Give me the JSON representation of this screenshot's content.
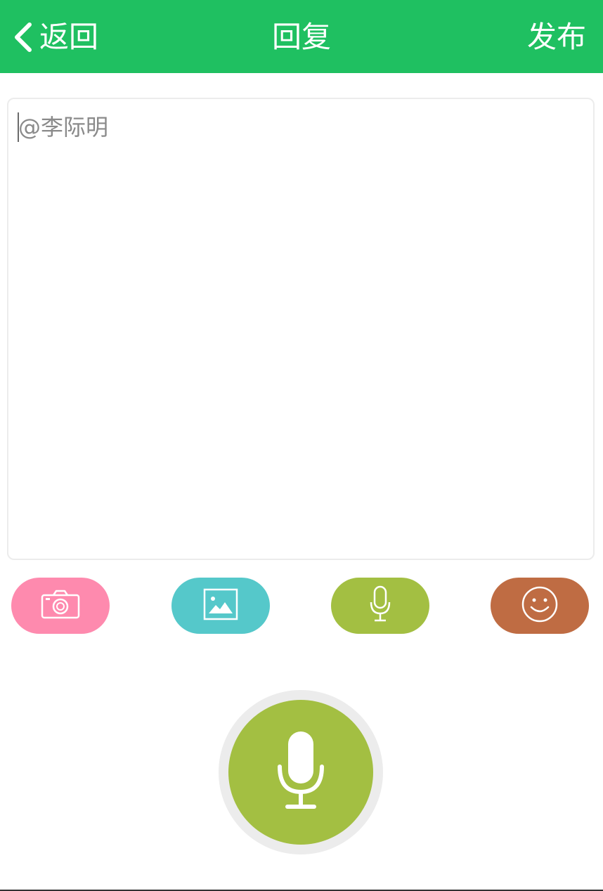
{
  "header": {
    "back_label": "返回",
    "title": "回复",
    "publish_label": "发布"
  },
  "reply": {
    "placeholder": "@李际明",
    "value": ""
  },
  "toolbar": {
    "items": [
      {
        "icon": "camera-icon",
        "color": "#fe8aae"
      },
      {
        "icon": "image-icon",
        "color": "#55c8ca"
      },
      {
        "icon": "microphone-icon",
        "color": "#a3bf42"
      },
      {
        "icon": "smiley-icon",
        "color": "#bf6c43"
      }
    ]
  },
  "record": {
    "icon": "microphone-icon",
    "color": "#a3bf42",
    "ring_color": "#ececec"
  },
  "colors": {
    "header_bg": "#1fc061",
    "header_text": "#ffffff"
  }
}
